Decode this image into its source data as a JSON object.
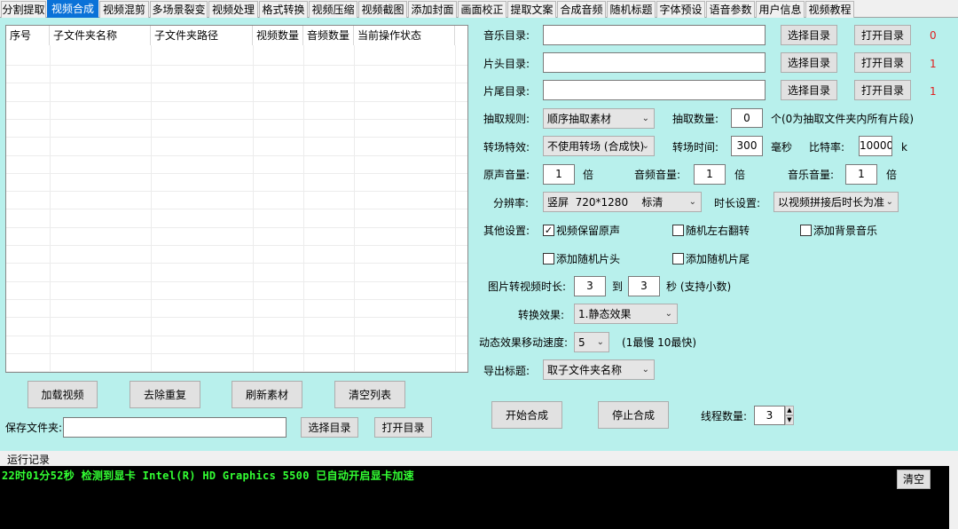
{
  "tabs": [
    "分割提取",
    "视频合成",
    "视频混剪",
    "多场景裂变",
    "视频处理",
    "格式转换",
    "视频压缩",
    "视频截图",
    "添加封面",
    "画面校正",
    "提取文案",
    "合成音频",
    "随机标题",
    "字体预设",
    "语音参数",
    "用户信息",
    "视频教程"
  ],
  "active_tab": "视频合成",
  "table": {
    "columns": [
      "序号",
      "子文件夹名称",
      "子文件夹路径",
      "视频数量",
      "音频数量",
      "当前操作状态"
    ],
    "rows": []
  },
  "left_buttons": {
    "load": "加载视频",
    "dedupe": "去除重复",
    "refresh": "刷新素材",
    "clear_list": "清空列表"
  },
  "save_folder": {
    "label": "保存文件夹:",
    "value": "",
    "choose": "选择目录",
    "open": "打开目录"
  },
  "dirs": [
    {
      "label": "音乐目录:",
      "value": "",
      "choose": "选择目录",
      "open": "打开目录",
      "count": "0",
      "count_color": "#e02020"
    },
    {
      "label": "片头目录:",
      "value": "",
      "choose": "选择目录",
      "open": "打开目录",
      "count": "1",
      "count_color": "#e02020"
    },
    {
      "label": "片尾目录:",
      "value": "",
      "choose": "选择目录",
      "open": "打开目录",
      "count": "1",
      "count_color": "#e02020"
    }
  ],
  "extract": {
    "rule_label": "抽取规则:",
    "rule_value": "顺序抽取素材",
    "count_label": "抽取数量:",
    "count_value": "0",
    "count_hint": "个(0为抽取文件夹内所有片段)"
  },
  "transition": {
    "effect_label": "转场特效:",
    "effect_value": "不使用转场 (合成快)",
    "time_label": "转场时间:",
    "time_value": "300",
    "time_unit": "毫秒",
    "bitrate_label": "比特率:",
    "bitrate_value": "10000",
    "bitrate_unit": "k"
  },
  "volume": {
    "orig_label": "原声音量:",
    "orig_value": "1",
    "orig_unit": "倍",
    "audio_label": "音频音量:",
    "audio_value": "1",
    "audio_unit": "倍",
    "music_label": "音乐音量:",
    "music_value": "1",
    "music_unit": "倍"
  },
  "resolution": {
    "label": "分辨率:",
    "value": "竖屏  720*1280    标清",
    "duration_label": "时长设置:",
    "duration_value": "以视频拼接后时长为准"
  },
  "other": {
    "label": "其他设置:",
    "options": [
      {
        "label": "视频保留原声",
        "checked": true
      },
      {
        "label": "随机左右翻转",
        "checked": false
      },
      {
        "label": "添加背景音乐",
        "checked": false
      },
      {
        "label": "添加随机片头",
        "checked": false
      },
      {
        "label": "添加随机片尾",
        "checked": false
      }
    ]
  },
  "image_dur": {
    "label": "图片转视频时长:",
    "from": "3",
    "to_label": "到",
    "to": "3",
    "unit": "秒 (支持小数)"
  },
  "convert": {
    "label": "转换效果:",
    "value": "1.静态效果"
  },
  "speed": {
    "label": "动态效果移动速度:",
    "value": "5",
    "hint": "(1最慢 10最快)"
  },
  "export": {
    "label": "导出标题:",
    "value": "取子文件夹名称"
  },
  "actions": {
    "start": "开始合成",
    "stop": "停止合成",
    "threads_label": "线程数量:",
    "threads_value": "3"
  },
  "log": {
    "title": "运行记录",
    "line": "22时01分52秒 检测到显卡 Intel(R) HD Graphics 5500 已自动开启显卡加速",
    "clear": "清空"
  }
}
